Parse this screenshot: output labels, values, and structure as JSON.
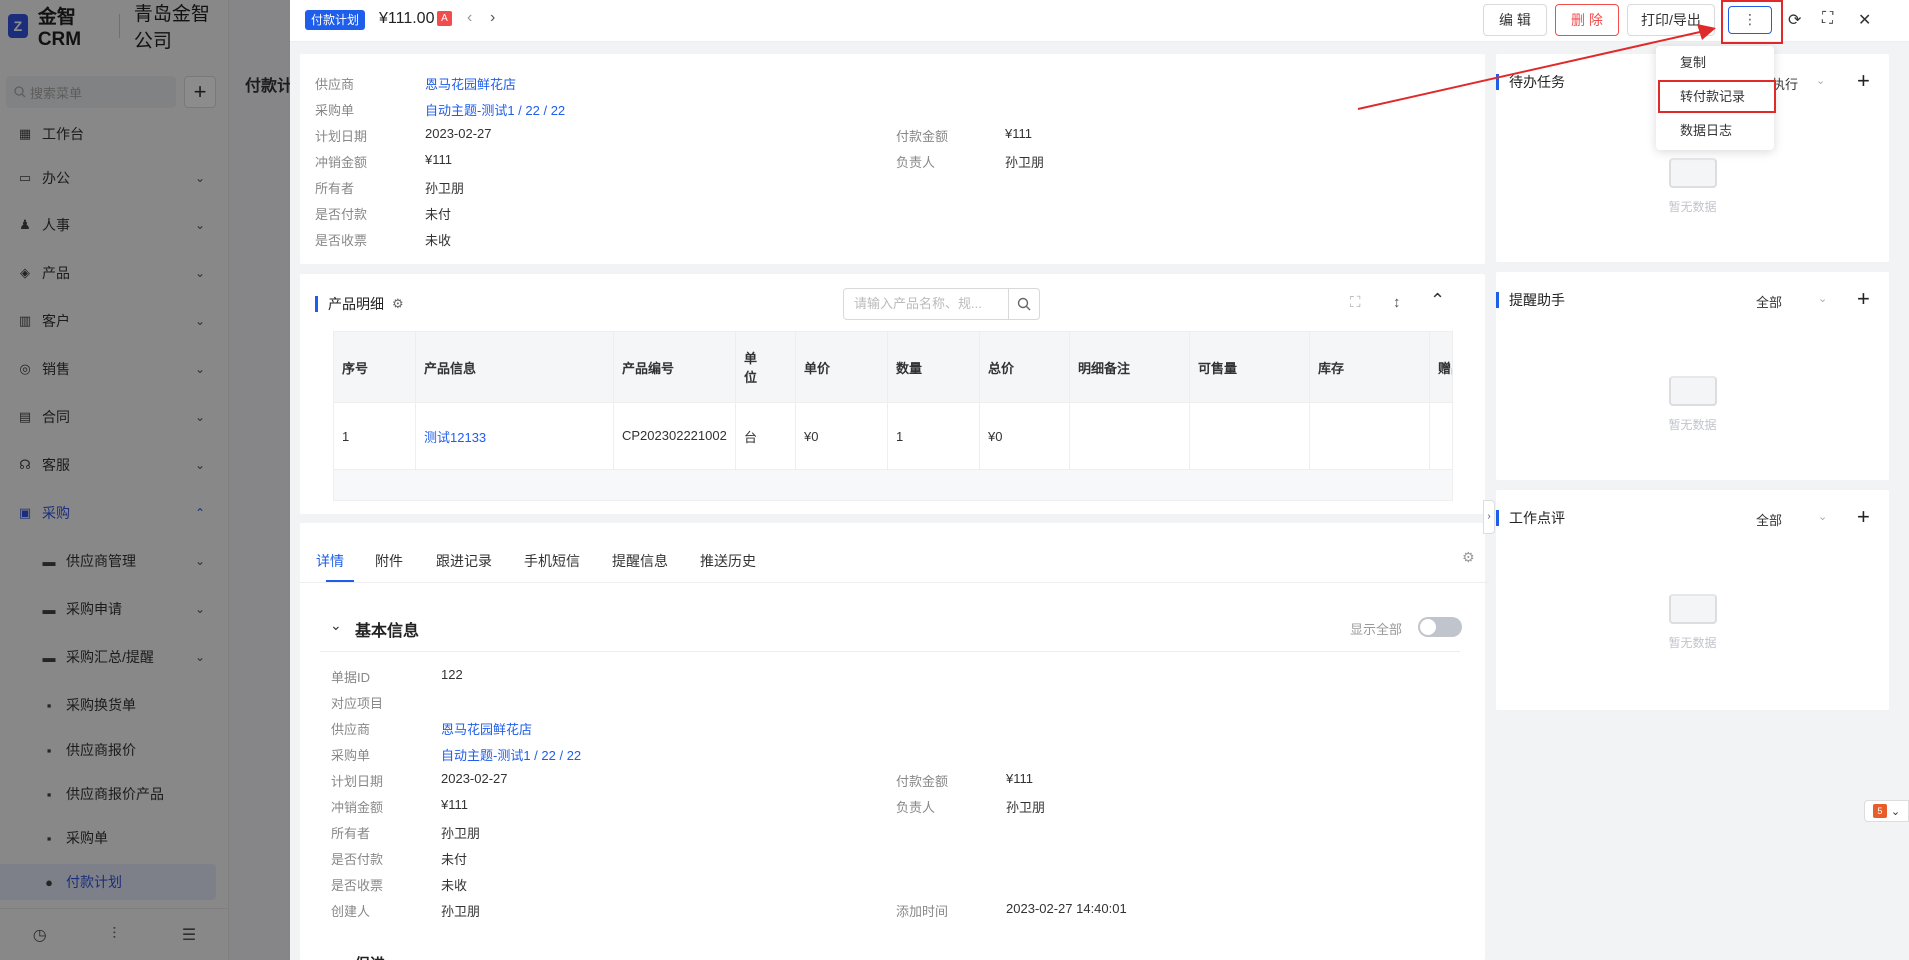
{
  "app": {
    "brand": "金智CRM",
    "company": "青岛金智公司",
    "logo_letter": "Z"
  },
  "sidebar": {
    "search_placeholder": "搜索菜单",
    "items": [
      {
        "label": "工作台",
        "icon": "dashboard-icon"
      },
      {
        "label": "办公",
        "icon": "office-icon"
      },
      {
        "label": "人事",
        "icon": "people-icon"
      },
      {
        "label": "产品",
        "icon": "cube-icon"
      },
      {
        "label": "客户",
        "icon": "chart-icon"
      },
      {
        "label": "销售",
        "icon": "sales-icon"
      },
      {
        "label": "合同",
        "icon": "contract-icon"
      },
      {
        "label": "客服",
        "icon": "service-icon"
      },
      {
        "label": "采购",
        "icon": "purchase-icon"
      },
      {
        "label": "供应商管理",
        "icon": "folder-icon"
      },
      {
        "label": "采购申请",
        "icon": "folder-icon"
      },
      {
        "label": "采购汇总/提醒",
        "icon": "folder-icon"
      },
      {
        "label": "采购换货单",
        "icon": "doc-icon"
      },
      {
        "label": "供应商报价",
        "icon": "doc-icon"
      },
      {
        "label": "供应商报价产品",
        "icon": "doc-icon"
      },
      {
        "label": "采购单",
        "icon": "doc-icon"
      },
      {
        "label": "付款计划",
        "icon": "dot-icon"
      }
    ]
  },
  "background": {
    "page_title": "付款计"
  },
  "drawer": {
    "header": {
      "tag": "付款计划",
      "amount": "¥111.00",
      "flag": "A",
      "edit_label": "编 辑",
      "delete_label": "删 除",
      "print_label": "打印/导出",
      "more_label": "⋮"
    },
    "dropdown": {
      "items": [
        "复制",
        "转付款记录",
        "数据日志"
      ]
    },
    "summary": {
      "supplier_label": "供应商",
      "supplier": "恩马花园鲜花店",
      "po_label": "采购单",
      "po": "自动主题-测试1 / 22 / 22",
      "plan_date_label": "计划日期",
      "plan_date": "2023-02-27",
      "pay_amount_label": "付款金额",
      "pay_amount": "¥111",
      "offset_label": "冲销金额",
      "offset": "¥111",
      "owner_person_label": "负责人",
      "owner_person": "孙卫朋",
      "owner_label": "所有者",
      "owner": "孙卫朋",
      "paid_label": "是否付款",
      "paid": "未付",
      "invoice_label": "是否收票",
      "invoice": "未收"
    },
    "products": {
      "title": "产品明细",
      "search_placeholder": "请输入产品名称、规...",
      "columns": [
        "序号",
        "产品信息",
        "产品编号",
        "单位",
        "单价",
        "数量",
        "总价",
        "明细备注",
        "可售量",
        "库存",
        "赠品"
      ],
      "rows": [
        [
          "1",
          "测试12133",
          "CP202302221002",
          "台",
          "¥0",
          "1",
          "¥0",
          "",
          "",
          "",
          ""
        ]
      ]
    },
    "tabs": [
      "详情",
      "附件",
      "跟进记录",
      "手机短信",
      "提醒信息",
      "推送历史"
    ],
    "basic_info": {
      "title": "基本信息",
      "show_all_label": "显示全部",
      "id_label": "单据ID",
      "id": "122",
      "project_label": "对应项目",
      "project": "",
      "supplier_label": "供应商",
      "supplier": "恩马花园鲜花店",
      "po_label": "采购单",
      "po": "自动主题-测试1 / 22 / 22",
      "plan_date_label": "计划日期",
      "plan_date": "2023-02-27",
      "pay_amount_label": "付款金额",
      "pay_amount": "¥111",
      "offset_label": "冲销金额",
      "offset": "¥111",
      "owner_person_label": "负责人",
      "owner_person": "孙卫朋",
      "owner_label": "所有者",
      "owner": "孙卫朋",
      "paid_label": "是否付款",
      "paid": "未付",
      "invoice_label": "是否收票",
      "invoice": "未收",
      "creator_label": "创建人",
      "creator": "孙卫朋",
      "created_at_label": "添加时间",
      "created_at": "2023-02-27 14:40:01",
      "next_section": "促进"
    },
    "right_panel": {
      "todo": {
        "title": "待办任务",
        "filter": "执行",
        "empty": "暂无数据"
      },
      "reminder": {
        "title": "提醒助手",
        "filter": "全部",
        "empty": "暂无数据"
      },
      "review": {
        "title": "工作点评",
        "filter": "全部",
        "empty": "暂无数据"
      }
    }
  },
  "colors": {
    "accent": "#1f5eea",
    "danger": "#f24c4c",
    "annotation": "#e02a2a"
  }
}
